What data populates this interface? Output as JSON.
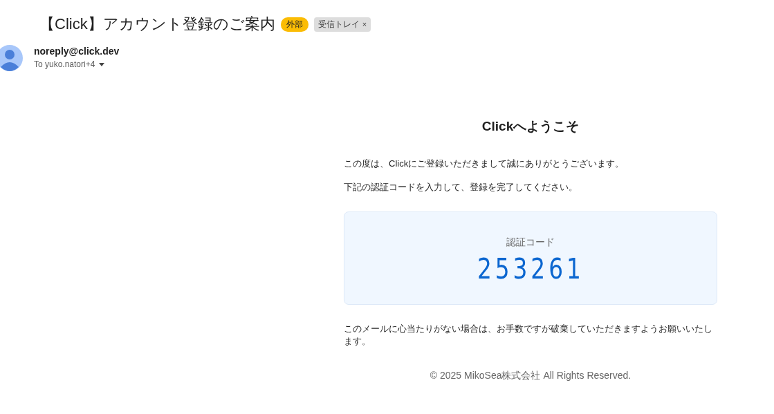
{
  "subject": "【Click】アカウント登録のご案内",
  "labels": [
    {
      "kind": "external",
      "text": "外部"
    },
    {
      "kind": "inbox",
      "text": "受信トレイ",
      "remove": "×"
    }
  ],
  "sender": {
    "address": "noreply@click.dev",
    "recipients": "To yuko.natori+4"
  },
  "body": {
    "heading": "Clickへようこそ",
    "paragraphs": [
      "この度は、Clickにご登録いただきまして誠にありがとうございます。",
      "下記の認証コードを入力して、登録を完了してください。"
    ],
    "code_label": "認証コード",
    "code": "253261",
    "closing": "このメールに心当たりがない場合は、お手数ですが破棄していただきますようお願いいたします。",
    "footer": "© 2025 MikoSea株式会社 All Rights Reserved."
  }
}
